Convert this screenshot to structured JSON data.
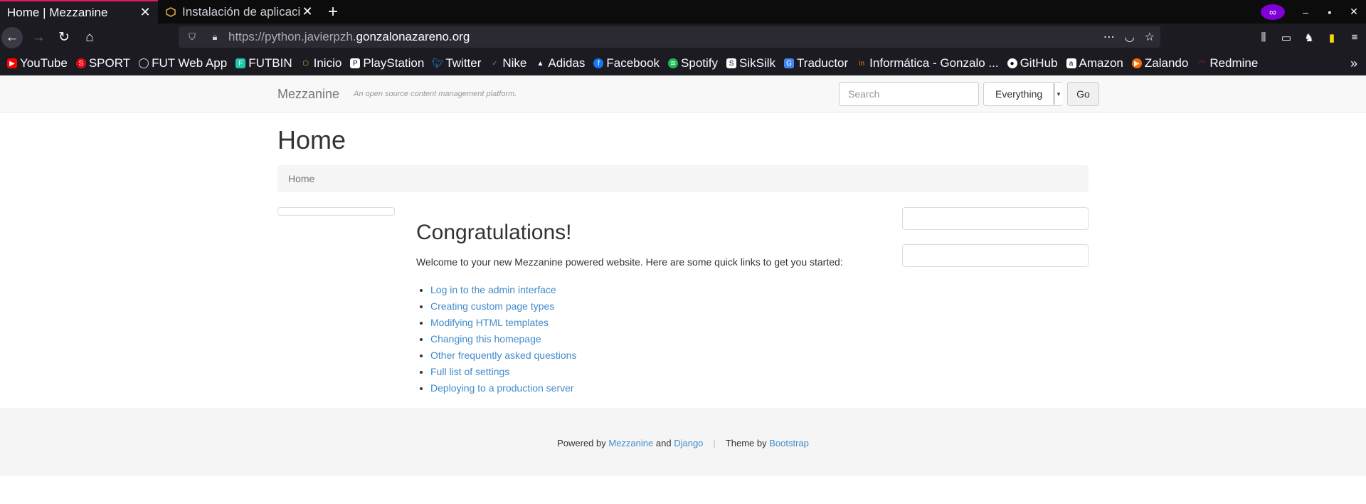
{
  "browser": {
    "tabs": [
      {
        "title": "Home | Mezzanine",
        "active": true
      },
      {
        "title": "Instalación de aplicaci",
        "active": false
      }
    ],
    "url_prefix": "https://python.javierpzh.",
    "url_domain": "gonzalonazareno.org",
    "bookmarks": [
      {
        "label": "YouTube",
        "icon": "youtube-icon",
        "color": "#ff0000"
      },
      {
        "label": "SPORT",
        "icon": "sport-icon",
        "color": "#e30613"
      },
      {
        "label": "FUT Web App",
        "icon": "globe-icon",
        "color": "#888888"
      },
      {
        "label": "FUTBIN",
        "icon": "futbin-icon",
        "color": "#1fc9a8"
      },
      {
        "label": "Inicio",
        "icon": "home-cube-icon",
        "color": "#c9a227"
      },
      {
        "label": "PlayStation",
        "icon": "playstation-icon",
        "color": "#ffffff"
      },
      {
        "label": "Twitter",
        "icon": "twitter-icon",
        "color": "#1da1f2"
      },
      {
        "label": "Nike",
        "icon": "nike-icon",
        "color": "#555555"
      },
      {
        "label": "Adidas",
        "icon": "adidas-icon",
        "color": "#ffffff"
      },
      {
        "label": "Facebook",
        "icon": "facebook-icon",
        "color": "#1877f2"
      },
      {
        "label": "Spotify",
        "icon": "spotify-icon",
        "color": "#1db954"
      },
      {
        "label": "SikSilk",
        "icon": "siksilk-icon",
        "color": "#ffffff"
      },
      {
        "label": "Traductor",
        "icon": "translate-icon",
        "color": "#4285f4"
      },
      {
        "label": "Informática - Gonzalo ...",
        "icon": "informatica-icon",
        "color": "#f57c00"
      },
      {
        "label": "GitHub",
        "icon": "github-icon",
        "color": "#ffffff"
      },
      {
        "label": "Amazon",
        "icon": "amazon-icon",
        "color": "#ffffff"
      },
      {
        "label": "Zalando",
        "icon": "zalando-icon",
        "color": "#ff6900"
      },
      {
        "label": "Redmine",
        "icon": "redmine-icon",
        "color": "#b32024"
      }
    ]
  },
  "site": {
    "brand": "Mezzanine",
    "tagline": "An open source content management platform.",
    "search_placeholder": "Search",
    "search_scope": "Everything",
    "go_label": "Go"
  },
  "page": {
    "title": "Home",
    "breadcrumb": "Home",
    "heading": "Congratulations!",
    "intro": "Welcome to your new Mezzanine powered website. Here are some quick links to get you started:",
    "links": [
      "Log in to the admin interface",
      "Creating custom page types",
      "Modifying HTML templates",
      "Changing this homepage",
      "Other frequently asked questions",
      "Full list of settings",
      "Deploying to a production server"
    ]
  },
  "footer": {
    "powered_by": "Powered by",
    "mezzanine": "Mezzanine",
    "and": "and",
    "django": "Django",
    "separator": "|",
    "theme_by": "Theme by",
    "bootstrap": "Bootstrap"
  },
  "colors": {
    "accent_tab": "#e31b5d",
    "link": "#428bca",
    "private_browsing": "#8000d7"
  }
}
